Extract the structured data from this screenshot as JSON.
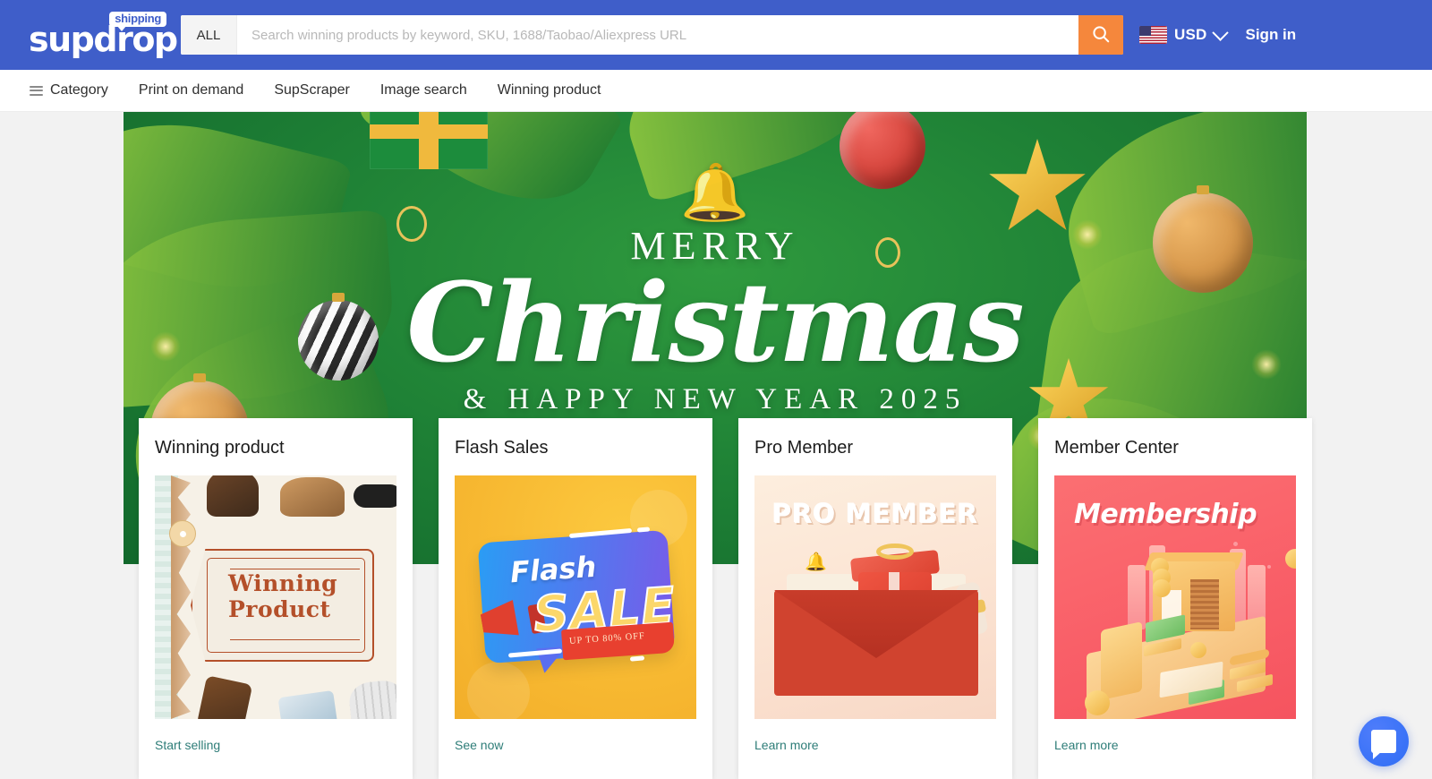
{
  "header": {
    "logo_text": "supdrop",
    "logo_badge": "shipping",
    "search": {
      "category_label": "ALL",
      "placeholder": "Search winning products by keyword, SKU, 1688/Taobao/Aliexpress URL",
      "value": "",
      "search_icon": "magnifier-icon",
      "button_color": "#f5873c"
    },
    "locale": {
      "flag": "us-flag-icon",
      "currency": "USD",
      "chevron": "chevron-down-icon"
    },
    "sign_in": "Sign in",
    "background_color": "#3f5ec9"
  },
  "nav": {
    "menu_icon": "hamburger-icon",
    "items": [
      {
        "label": "Category"
      },
      {
        "label": "Print on demand"
      },
      {
        "label": "SupScraper"
      },
      {
        "label": "Image search"
      },
      {
        "label": "Winning product"
      }
    ]
  },
  "banner": {
    "bell_icon": "christmas-bell-icon",
    "line1": "MERRY",
    "line2": "Christmas",
    "line3": "& HAPPY NEW YEAR 2025",
    "background_color": "#1f8236"
  },
  "cards": [
    {
      "title": "Winning product",
      "link": "Start selling",
      "art": {
        "kind": "winning-product-tag",
        "tag_line1": "Winning",
        "tag_line2": "Product"
      }
    },
    {
      "title": "Flash Sales",
      "link": "See now",
      "art": {
        "kind": "flash-sale-banner",
        "flash_word": "Flash",
        "sale_word": "SALE",
        "discount": "UP TO 80% OFF"
      }
    },
    {
      "title": "Pro Member",
      "link": "Learn more",
      "art": {
        "kind": "pro-member-envelope",
        "heading": "PRO MEMBER"
      }
    },
    {
      "title": "Member Center",
      "link": "Learn more",
      "art": {
        "kind": "membership-illustration",
        "heading": "Membership"
      }
    }
  ],
  "chat_widget": {
    "icon": "chat-bubble-icon",
    "color": "#2f6df5"
  }
}
